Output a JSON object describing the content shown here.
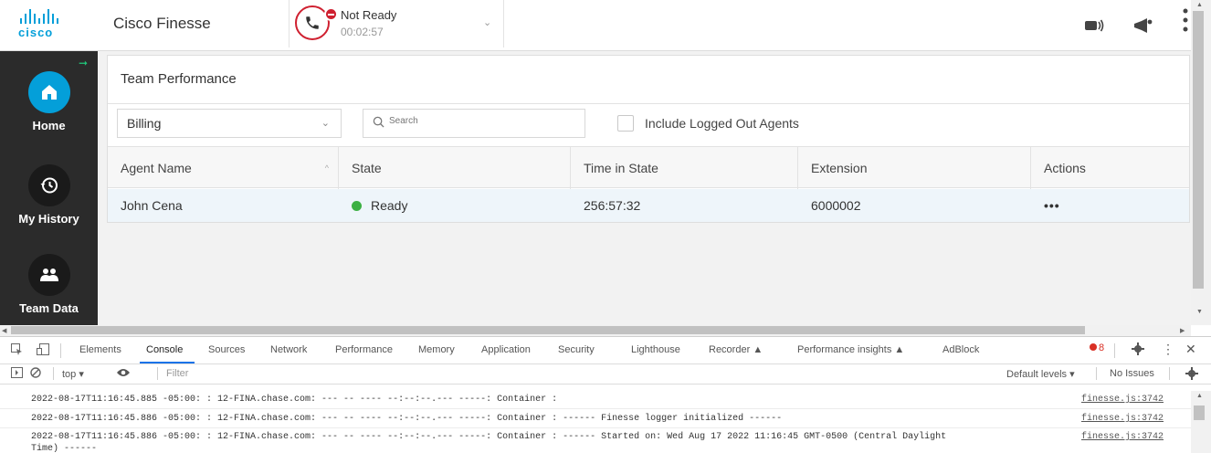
{
  "header": {
    "logo_text": "cisco",
    "app_title": "Cisco Finesse",
    "agent_state": "Not Ready",
    "state_timer": "00:02:57"
  },
  "sidebar": {
    "items": [
      {
        "label": "Home",
        "icon": "home-icon",
        "active": true
      },
      {
        "label": "My History",
        "icon": "history-icon",
        "active": false
      },
      {
        "label": "Team Data",
        "icon": "team-icon",
        "active": false
      }
    ]
  },
  "team_performance": {
    "title": "Team Performance",
    "team_selected": "Billing",
    "search_placeholder": "Search",
    "include_logged_out_label": "Include Logged Out Agents",
    "include_logged_out_checked": false,
    "columns": [
      "Agent Name",
      "State",
      "Time in State",
      "Extension",
      "Actions"
    ],
    "rows": [
      {
        "agent_name": "John Cena",
        "state": "Ready",
        "state_color": "#3cb043",
        "time_in_state": "256:57:32",
        "extension": "6000002",
        "actions": "•••"
      }
    ]
  },
  "devtools": {
    "tabs": [
      "Elements",
      "Console",
      "Sources",
      "Network",
      "Performance",
      "Memory",
      "Application",
      "Security",
      "Lighthouse",
      "Recorder",
      "Performance insights",
      "AdBlock"
    ],
    "active_tab": "Console",
    "error_count": "8",
    "context": "top",
    "filter_placeholder": "Filter",
    "levels": "Default levels",
    "issues": "No Issues",
    "logs": [
      {
        "message": "2022-08-17T11:16:45.885 -05:00: : 12-FINA.chase.com: --- -- ---- --:--:--.--- -----: Container :",
        "source": "finesse.js:3742"
      },
      {
        "message": "2022-08-17T11:16:45.886 -05:00: : 12-FINA.chase.com: --- -- ---- --:--:--.--- -----: Container : ------ Finesse logger initialized ------",
        "source": "finesse.js:3742"
      },
      {
        "message": "2022-08-17T11:16:45.886 -05:00: : 12-FINA.chase.com: --- -- ---- --:--:--.--- -----: Container : ------ Started on: Wed Aug 17 2022 11:16:45 GMT-0500 (Central Daylight",
        "continuation": "Time) ------",
        "source": "finesse.js:3742"
      }
    ]
  },
  "colors": {
    "accent_blue": "#049fd9",
    "not_ready_red": "#cf2030",
    "sidebar_bg": "#2b2b2b",
    "ready_green": "#3cb043"
  }
}
